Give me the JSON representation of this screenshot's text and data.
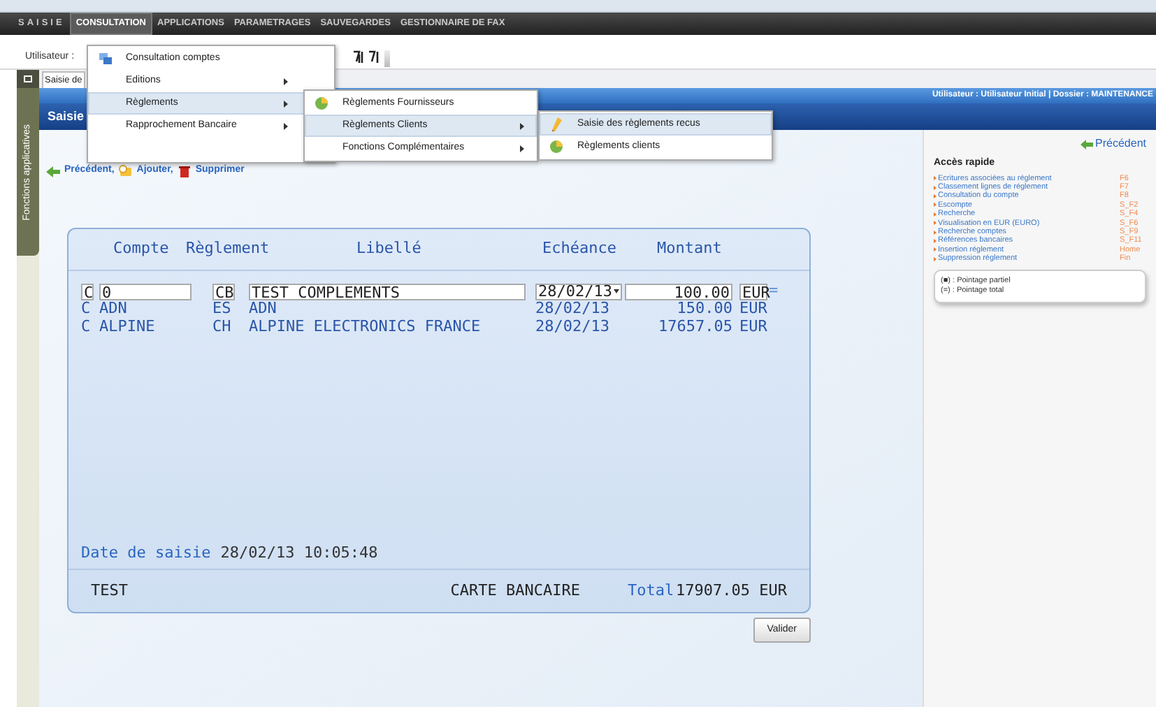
{
  "menu_bar": [
    {
      "label": "SAISIE",
      "selected": false
    },
    {
      "label": "CONSULTATION",
      "selected": true
    },
    {
      "label": "APPLICATIONS",
      "selected": false
    },
    {
      "label": "PARAMETRAGES",
      "selected": false
    },
    {
      "label": "SAUVEGARDES",
      "selected": false
    },
    {
      "label": "GESTIONNAIRE DE FAX",
      "selected": false
    }
  ],
  "toolbar": {
    "user_label": "Utilisateur :"
  },
  "side_tab": "Fonctions applicatives",
  "page_tab": "Saisie de",
  "session": "Utilisateur : Utilisateur Initial | Dossier : MAINTENANCE",
  "page_title": "Saisie",
  "actions": [
    {
      "label": "Précédent,",
      "kind": "back"
    },
    {
      "label": "Ajouter,",
      "kind": "add"
    },
    {
      "label": "Supprimer",
      "kind": "delete"
    }
  ],
  "grid": {
    "columns": [
      "Compte",
      "Règlement",
      "Libellé",
      "Echéance",
      "Montant"
    ],
    "rows": [
      {
        "kind": "edit",
        "sens": "C",
        "compte": "0",
        "reglement": "CB",
        "libelle": "TEST COMPLEMENTS",
        "echeance": "28/02/13",
        "montant": "100.00",
        "devise": "EUR",
        "mark": "="
      },
      {
        "kind": "text",
        "sens": "C",
        "compte": "ADN",
        "reglement": "ES",
        "libelle": "ADN",
        "echeance": "28/02/13",
        "montant": "150.00",
        "devise": "EUR"
      },
      {
        "kind": "text",
        "sens": "C",
        "compte": "ALPINE",
        "reglement": "CH",
        "libelle": "ALPINE ELECTRONICS FRANCE",
        "echeance": "28/02/13",
        "montant": "17657.05",
        "devise": "EUR"
      }
    ],
    "date_label": "Date de saisie",
    "date_value": "28/02/13 10:05:48",
    "footer": {
      "reference": "TEST",
      "payment": "CARTE BANCAIRE",
      "total_label": "Total",
      "total_value": "17907.05 EUR"
    }
  },
  "submit_button": "Valider",
  "quick_panel": {
    "back_link": "Précédent",
    "title": "Accès rapide",
    "items": [
      {
        "label": "Ecritures associées au réglement",
        "key": "F6"
      },
      {
        "label": "Classement lignes de réglement",
        "key": "F7"
      },
      {
        "label": "Consultation du compte",
        "key": "F8"
      },
      {
        "label": "Escompte",
        "key": "S_F2"
      },
      {
        "label": "Recherche",
        "key": "S_F4"
      },
      {
        "label": "Visualisation en EUR (EURO)",
        "key": "S_F6"
      },
      {
        "label": "Recherche comptes",
        "key": "S_F9"
      },
      {
        "label": "Références bancaires",
        "key": "S_F11"
      },
      {
        "label": "Insertion réglement",
        "key": "Home"
      },
      {
        "label": "Suppression réglement",
        "key": "Fin"
      }
    ],
    "legend": [
      "(■) : Pointage partiel",
      "(=) : Pointage total"
    ]
  },
  "menus": [
    [
      {
        "label": "Consultation comptes",
        "kind": "accounts",
        "submenu": false,
        "selected": false
      },
      {
        "label": "Editions",
        "submenu": true,
        "selected": false
      },
      {
        "label": "Règlements",
        "submenu": true,
        "selected": true
      },
      {
        "label": "Rapprochement Bancaire",
        "submenu": true,
        "selected": false
      }
    ],
    [
      {
        "label": "Règlements Fournisseurs",
        "kind": "disc",
        "submenu": false,
        "selected": false
      },
      {
        "label": "Règlements Clients",
        "submenu": true,
        "selected": true
      },
      {
        "label": "Fonctions Complémentaires",
        "submenu": true,
        "selected": false
      }
    ],
    [
      {
        "label": "Saisie des règlements recus",
        "kind": "pencil",
        "submenu": false,
        "selected": true
      },
      {
        "label": "Règlements clients",
        "kind": "disc",
        "submenu": false,
        "selected": false
      }
    ]
  ]
}
